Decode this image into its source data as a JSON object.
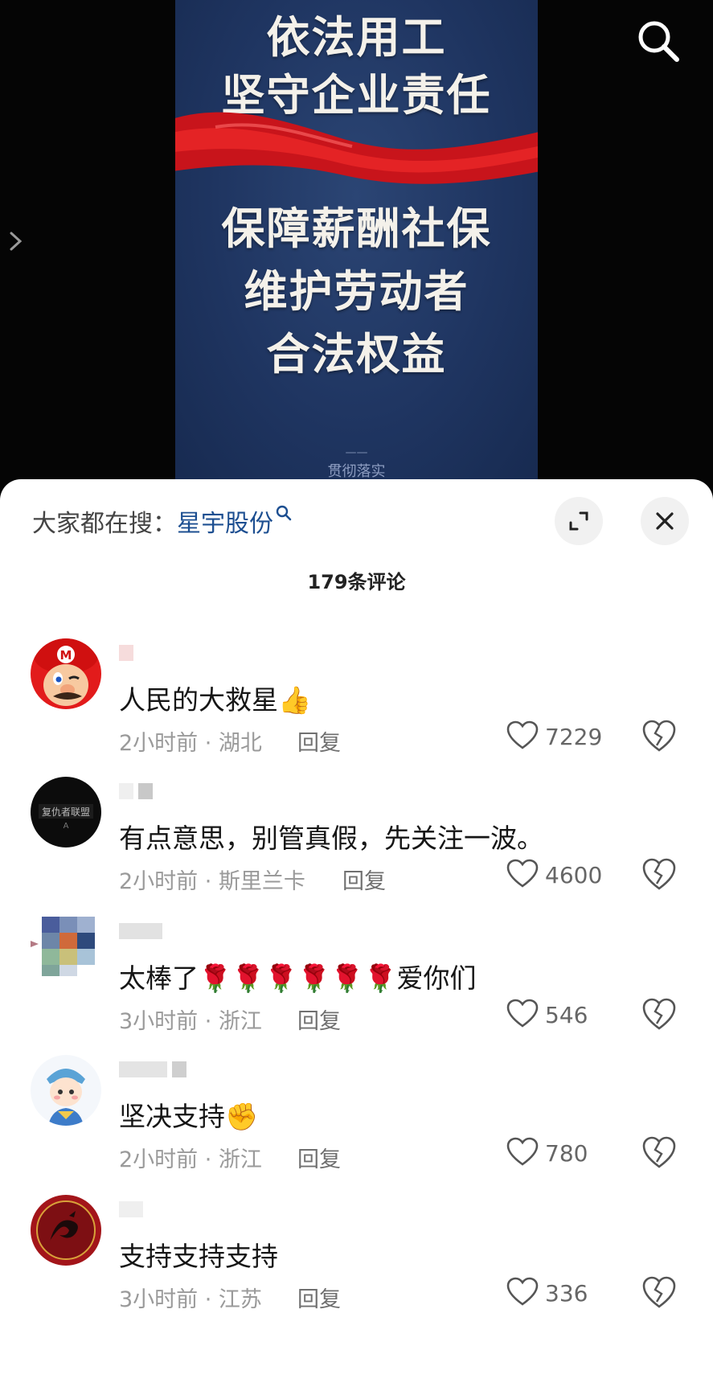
{
  "video": {
    "poster_lines": [
      "依法用工",
      "坚守企业责任",
      "保障薪酬社保",
      "维护劳动者",
      "合法权益"
    ],
    "footer_dash": "——",
    "footer_text": "贯彻落实",
    "search_icon": "search-icon",
    "side_icon": "chevron-right-icon"
  },
  "sheet": {
    "hot_search_label": "大家都在搜：",
    "hot_search_keyword": "星宇股份",
    "comment_count": "179条评论",
    "expand_icon": "expand-icon",
    "close_icon": "close-icon"
  },
  "comments": [
    {
      "avatar": "mario-avatar",
      "text": "人民的大救星👍",
      "meta": "2小时前 · 湖北",
      "reply": "回复",
      "likes": "7229"
    },
    {
      "avatar": "league-logo-avatar",
      "text": "有点意思，别管真假，先关注一波。",
      "meta": "2小时前 · 斯里兰卡",
      "reply": "回复",
      "likes": "4600"
    },
    {
      "avatar": "mosaic-avatar",
      "text": "太棒了🌹🌹🌹🌹🌹🌹爱你们",
      "meta": "3小时前 · 浙江",
      "reply": "回复",
      "likes": "546"
    },
    {
      "avatar": "cartoon-boy-avatar",
      "text": "坚决支持✊",
      "meta": "2小时前 · 浙江",
      "reply": "回复",
      "likes": "780"
    },
    {
      "avatar": "dragon-avatar",
      "text": "支持支持支持",
      "meta": "3小时前 · 江苏",
      "reply": "回复",
      "likes": "336"
    }
  ],
  "colors": {
    "poster_bg": "#1f3561",
    "ribbon": "#c8141b",
    "link": "#1d4f91"
  }
}
